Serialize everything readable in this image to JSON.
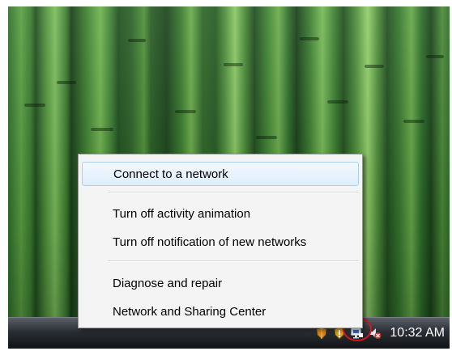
{
  "context_menu": {
    "items": [
      {
        "label": "Connect to a network"
      },
      {
        "label": "Turn off activity animation"
      },
      {
        "label": "Turn off notification of new networks"
      },
      {
        "label": "Diagnose and repair"
      },
      {
        "label": "Network and Sharing Center"
      }
    ],
    "highlighted_item": "Connect to a network"
  },
  "taskbar": {
    "clock": "10:32 AM",
    "tray_icons": [
      "security-shield-icon",
      "windows-security-alert-icon",
      "network-icon",
      "volume-muted-icon"
    ]
  },
  "colors": {
    "annotation_ring": "#d8141c",
    "menu_highlight": "#dfeefc",
    "taskbar": "#1a1d21"
  }
}
